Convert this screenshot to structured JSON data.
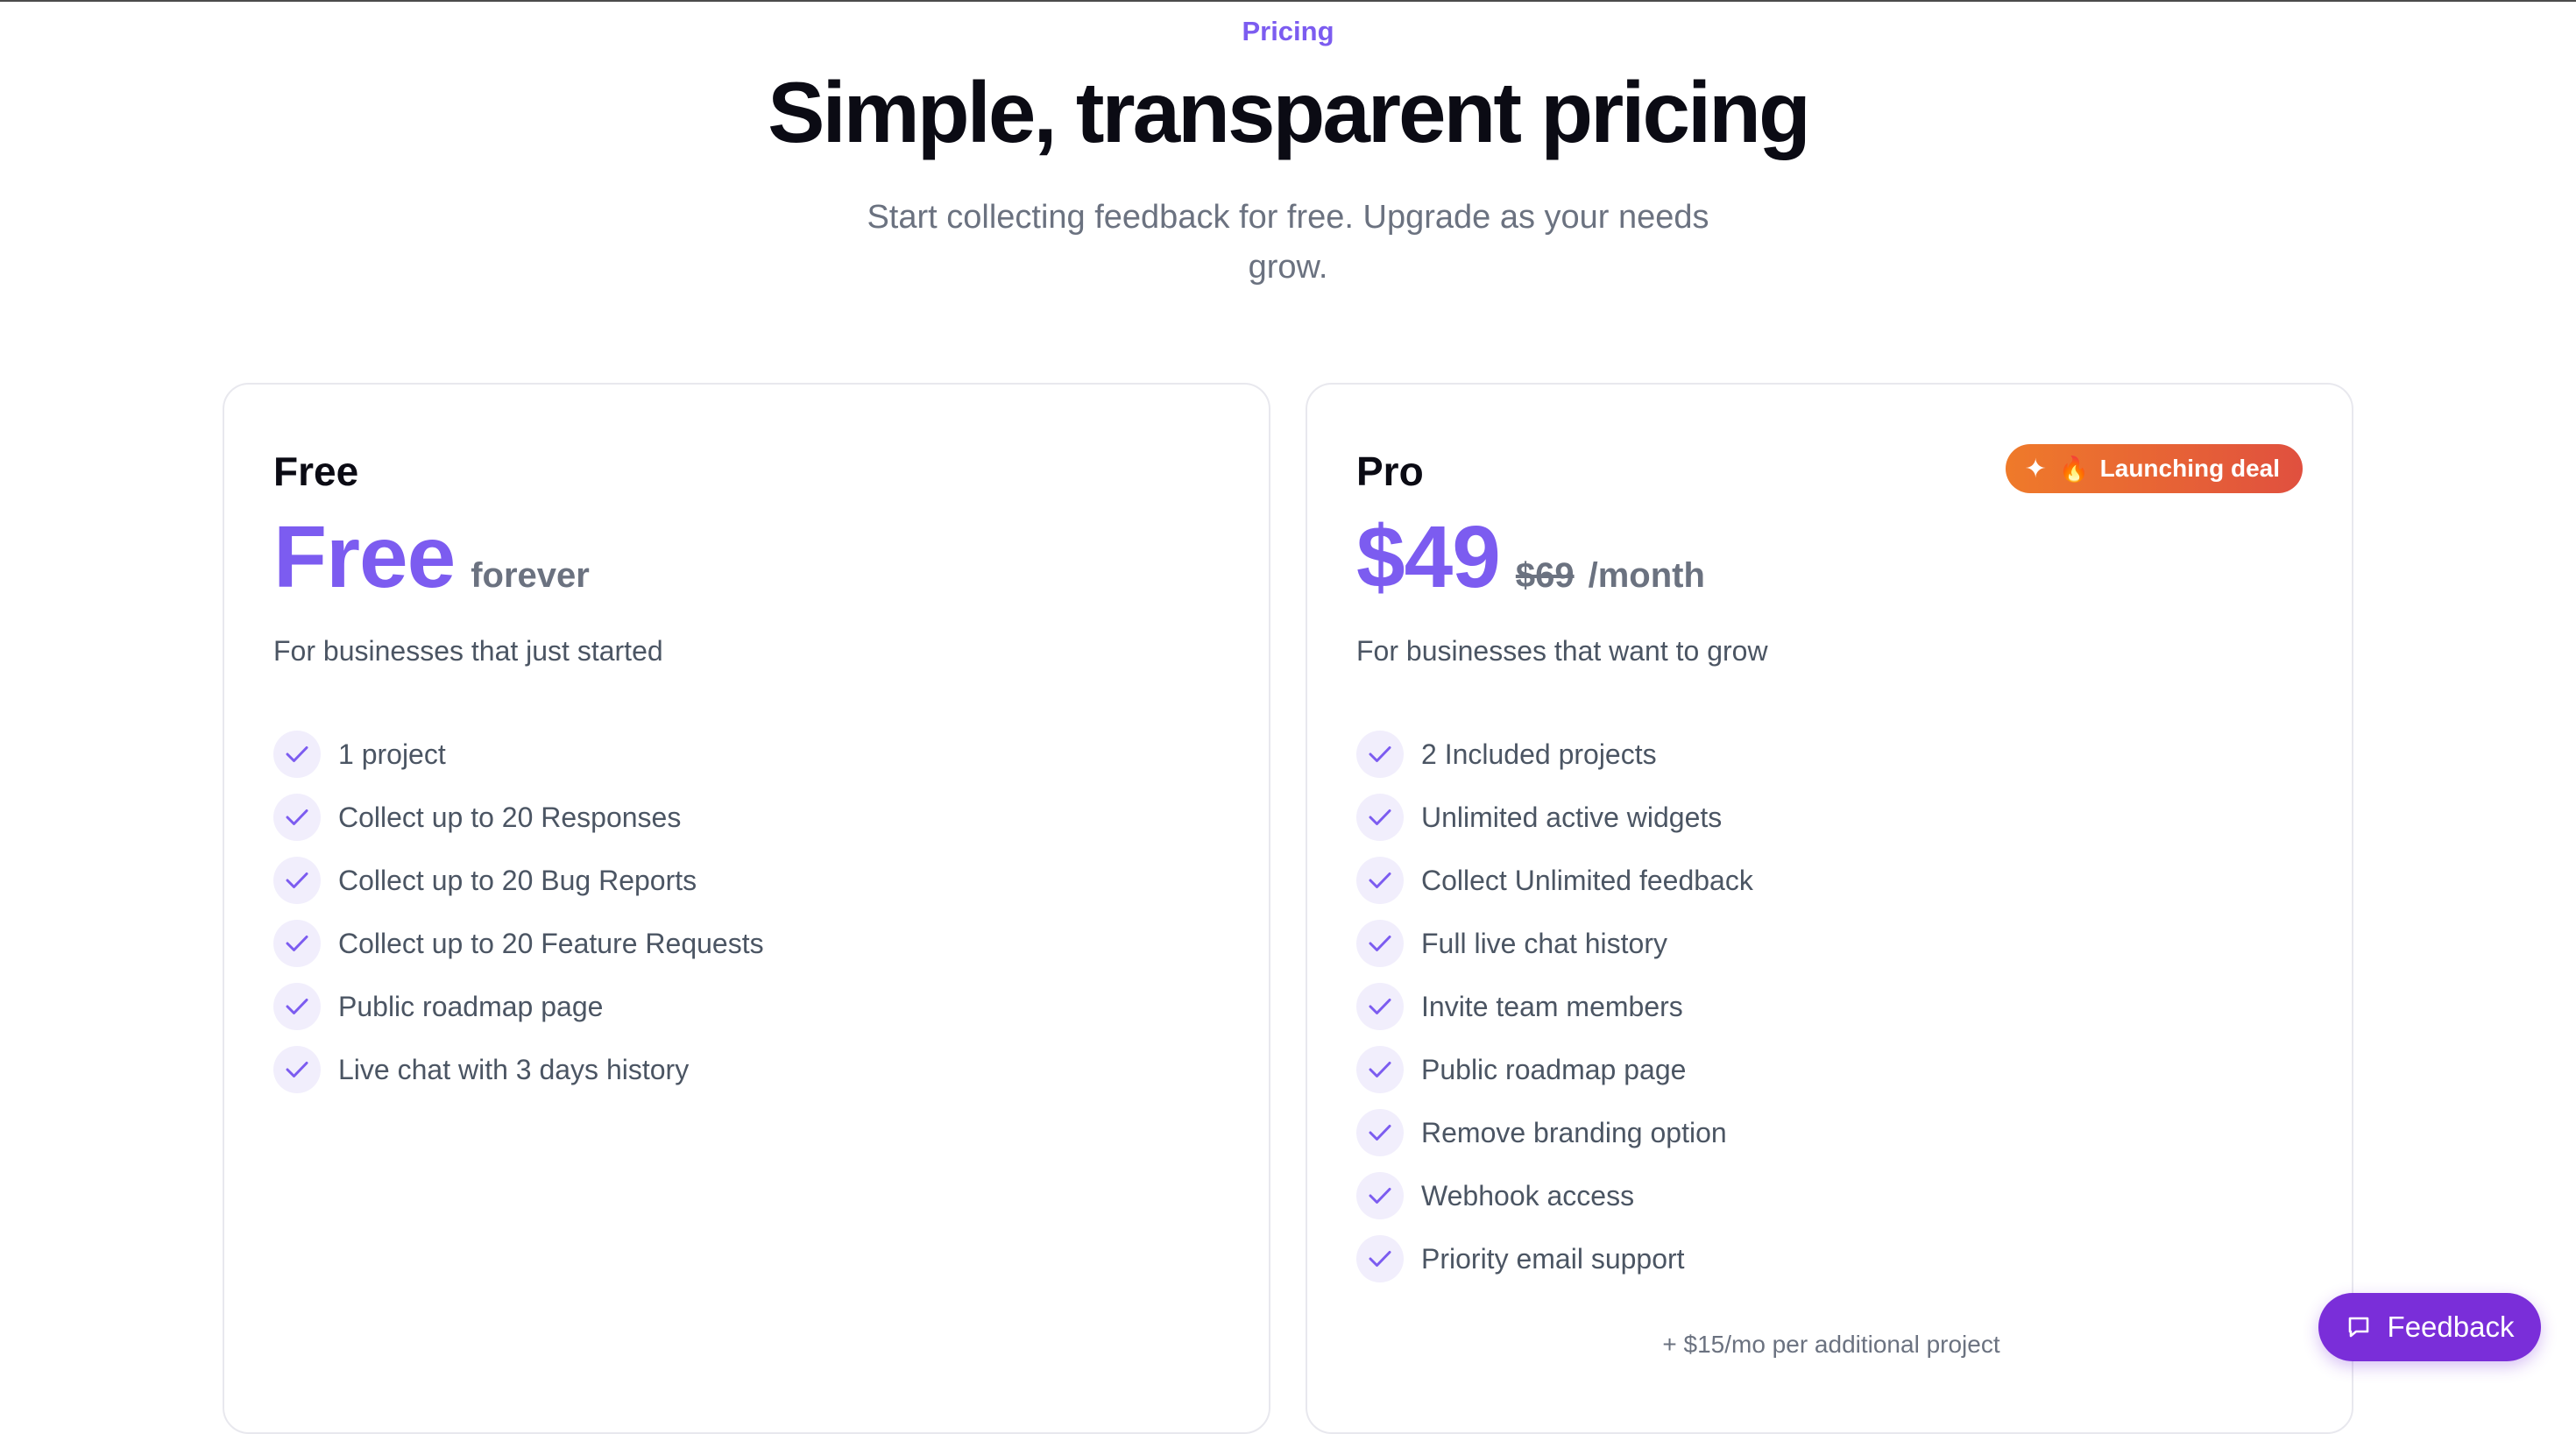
{
  "header": {
    "eyebrow": "Pricing",
    "title": "Simple, transparent pricing",
    "subtitle": "Start collecting feedback for free. Upgrade as your needs grow."
  },
  "plans": {
    "free": {
      "name": "Free",
      "price": "Free",
      "price_suffix": "forever",
      "description": "For businesses that just started",
      "features": [
        "1 project",
        "Collect up to 20 Responses",
        "Collect up to 20 Bug Reports",
        "Collect up to 20 Feature Requests",
        "Public roadmap page",
        "Live chat with 3 days history"
      ]
    },
    "pro": {
      "name": "Pro",
      "badge": "Launching deal",
      "badge_emoji": "🔥",
      "price": "$49",
      "old_price": "$69",
      "period": "/month",
      "description": "For businesses that want to grow",
      "features": [
        "2 Included projects",
        "Unlimited active widgets",
        "Collect Unlimited feedback",
        "Full live chat history",
        "Invite team members",
        "Public roadmap page",
        "Remove branding option",
        "Webhook access",
        "Priority email support"
      ],
      "addon_note": "+ $15/mo per additional project"
    }
  },
  "feedback_button": {
    "label": "Feedback",
    "icon": "chat-bubble-icon"
  },
  "colors": {
    "accent": "#7c5cf0",
    "check_bg": "#f1eefc",
    "badge_start": "#ef7a2a",
    "badge_end": "#e0503f",
    "feedback_bg": "#7a2ed9"
  }
}
